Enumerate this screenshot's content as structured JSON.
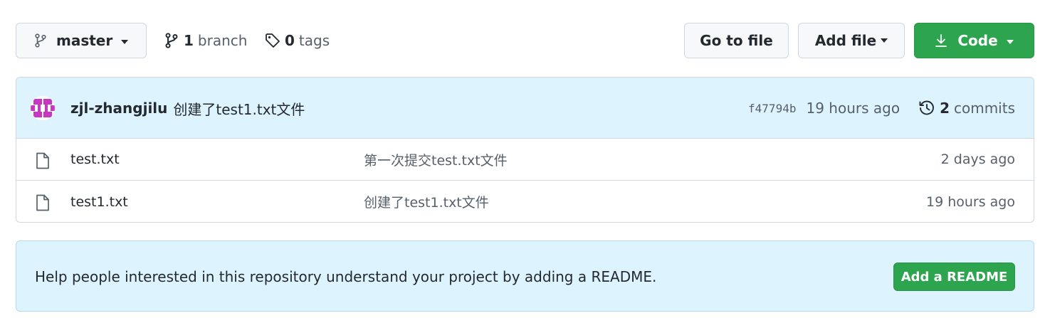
{
  "toolbar": {
    "branch_button": {
      "icon": "git-branch-icon",
      "label": "master"
    },
    "branches": {
      "icon": "git-branch-icon",
      "count": "1",
      "label": "branch"
    },
    "tags": {
      "icon": "tag-icon",
      "count": "0",
      "label": "tags"
    },
    "go_to_file_label": "Go to file",
    "add_file_label": "Add file",
    "code_button": {
      "icon": "download-icon",
      "label": "Code"
    }
  },
  "latest_commit": {
    "author": "zjl-zhangjilu",
    "message": "创建了test1.txt文件",
    "sha": "f47794b",
    "time": "19 hours ago",
    "history_icon": "history-icon",
    "commit_count": "2",
    "commits_label": "commits"
  },
  "files": [
    {
      "icon": "file-icon",
      "name": "test.txt",
      "commit_message": "第一次提交test.txt文件",
      "age": "2 days ago"
    },
    {
      "icon": "file-icon",
      "name": "test1.txt",
      "commit_message": "创建了test1.txt文件",
      "age": "19 hours ago"
    }
  ],
  "readme_banner": {
    "text": "Help people interested in this repository understand your project by adding a README.",
    "button_label": "Add a README"
  },
  "colors": {
    "primary_green": "#2da44e",
    "header_blue": "#ddf4ff",
    "border": "#d0d7de",
    "avatar_pink": "#c936c0"
  }
}
